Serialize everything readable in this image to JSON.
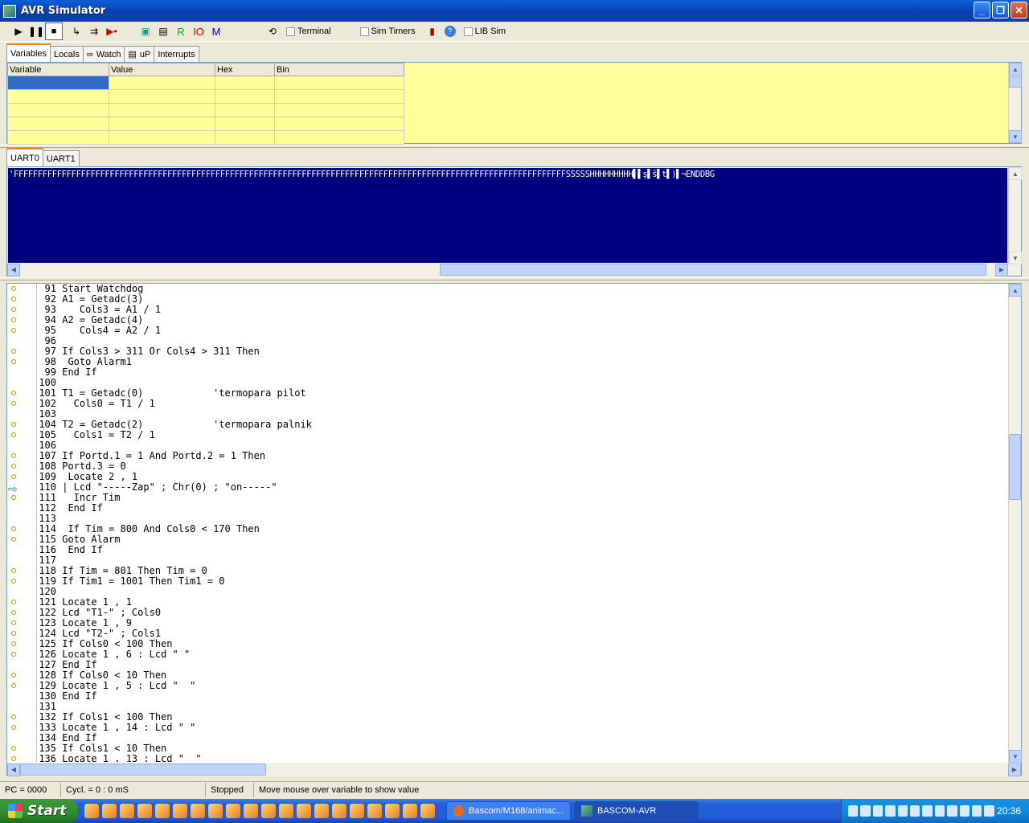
{
  "window": {
    "title": "AVR Simulator"
  },
  "toolbar": {
    "terminal_label": "Terminal",
    "sim_timers_label": "Sim Timers",
    "lib_sim_label": "LIB Sim",
    "r_label": "R",
    "io_label": "IO",
    "m_label": "M"
  },
  "top_tabs": [
    "Variables",
    "Locals",
    "Watch",
    "uP",
    "Interrupts"
  ],
  "variables_table": {
    "headers": [
      "Variable",
      "Value",
      "Hex",
      "Bin"
    ]
  },
  "uart_tabs": [
    "UART0",
    "UART1"
  ],
  "uart_output": "'FFFFFFFFFFFFFFFFFFFFFFFFFFFFFFFFFFFFFFFFFFFFFFFFFFFFFFFFFFFFFFFFFFFFFFFFFFFFFFFFFFFFFFFFFFFFFFFFFFFFFFFFFFFFFFFFFFFSSSSSHHHHHHHHH▌▌ş▌ŝ▌t▌)▌¬ENDDBG",
  "code_lines": [
    {
      "n": "91",
      "t": "Start Watchdog",
      "dot": true
    },
    {
      "n": "92",
      "t": "A1 = Getadc(3)",
      "dot": true
    },
    {
      "n": "93",
      "t": "   Cols3 = A1 / 1",
      "dot": true
    },
    {
      "n": "94",
      "t": "A2 = Getadc(4)",
      "dot": true
    },
    {
      "n": "95",
      "t": "   Cols4 = A2 / 1",
      "dot": true
    },
    {
      "n": "96",
      "t": "",
      "dot": false
    },
    {
      "n": "97",
      "t": "If Cols3 > 311 Or Cols4 > 311 Then",
      "dot": true
    },
    {
      "n": "98",
      "t": " Goto Alarm1",
      "dot": true
    },
    {
      "n": "99",
      "t": "End If",
      "dot": false
    },
    {
      "n": "100",
      "t": "",
      "dot": false
    },
    {
      "n": "101",
      "t": "T1 = Getadc(0)            'termopara pilot",
      "dot": true
    },
    {
      "n": "102",
      "t": "  Cols0 = T1 / 1",
      "dot": true
    },
    {
      "n": "103",
      "t": "",
      "dot": false
    },
    {
      "n": "104",
      "t": "T2 = Getadc(2)            'termopara palnik",
      "dot": true
    },
    {
      "n": "105",
      "t": "  Cols1 = T2 / 1",
      "dot": true
    },
    {
      "n": "106",
      "t": "",
      "dot": false
    },
    {
      "n": "107",
      "t": "If Portd.1 = 1 And Portd.2 = 1 Then",
      "dot": true
    },
    {
      "n": "108",
      "t": "Portd.3 = 0",
      "dot": true
    },
    {
      "n": "109",
      "t": " Locate 2 , 1",
      "dot": true
    },
    {
      "n": "110",
      "t": "| Lcd \"-----Zap\" ; Chr(0) ; \"on-----\"",
      "dot": false,
      "current": true
    },
    {
      "n": "111",
      "t": "  Incr Tim",
      "dot": true
    },
    {
      "n": "112",
      "t": " End If",
      "dot": false
    },
    {
      "n": "113",
      "t": "",
      "dot": false
    },
    {
      "n": "114",
      "t": " If Tim = 800 And Cols0 < 170 Then",
      "dot": true
    },
    {
      "n": "115",
      "t": "Goto Alarm",
      "dot": true
    },
    {
      "n": "116",
      "t": " End If",
      "dot": false
    },
    {
      "n": "117",
      "t": "",
      "dot": false
    },
    {
      "n": "118",
      "t": "If Tim = 801 Then Tim = 0",
      "dot": true
    },
    {
      "n": "119",
      "t": "If Tim1 = 1001 Then Tim1 = 0",
      "dot": true
    },
    {
      "n": "120",
      "t": "",
      "dot": false
    },
    {
      "n": "121",
      "t": "Locate 1 , 1",
      "dot": true
    },
    {
      "n": "122",
      "t": "Lcd \"T1-\" ; Cols0",
      "dot": true
    },
    {
      "n": "123",
      "t": "Locate 1 , 9",
      "dot": true
    },
    {
      "n": "124",
      "t": "Lcd \"T2-\" ; Cols1",
      "dot": true
    },
    {
      "n": "125",
      "t": "If Cols0 < 100 Then",
      "dot": true
    },
    {
      "n": "126",
      "t": "Locate 1 , 6 : Lcd \" \"",
      "dot": true
    },
    {
      "n": "127",
      "t": "End If",
      "dot": false
    },
    {
      "n": "128",
      "t": "If Cols0 < 10 Then",
      "dot": true
    },
    {
      "n": "129",
      "t": "Locate 1 , 5 : Lcd \"  \"",
      "dot": true
    },
    {
      "n": "130",
      "t": "End If",
      "dot": false
    },
    {
      "n": "131",
      "t": "",
      "dot": false
    },
    {
      "n": "132",
      "t": "If Cols1 < 100 Then",
      "dot": true
    },
    {
      "n": "133",
      "t": "Locate 1 , 14 : Lcd \" \"",
      "dot": true
    },
    {
      "n": "134",
      "t": "End If",
      "dot": false
    },
    {
      "n": "135",
      "t": "If Cols1 < 10 Then",
      "dot": true
    },
    {
      "n": "136",
      "t": "Locate 1 , 13 : Lcd \"  \"",
      "dot": true
    }
  ],
  "status": {
    "pc": "PC = 0000",
    "cycles": "Cycl. = 0 : 0 mS",
    "state": "Stopped",
    "hint": "Move mouse over variable to show value"
  },
  "taskbar": {
    "start_label": "Start",
    "tasks": [
      "Bascom/M168/animac...",
      "BASCOM-AVR"
    ],
    "clock": "20:36"
  },
  "colors": {
    "uart_bg": "#000080",
    "vars_bg": "#ffff99",
    "title_bar": "#0a5fd6"
  }
}
